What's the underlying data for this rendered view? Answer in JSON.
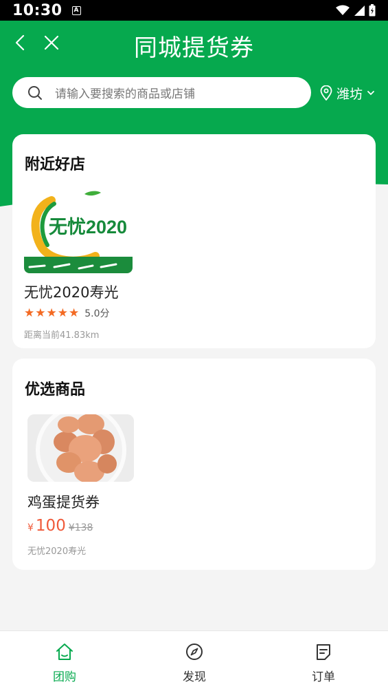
{
  "status_bar": {
    "time": "10:30",
    "notification_glyph": "A"
  },
  "nav": {
    "title": "同城提货券",
    "back_icon": "chevron-left-icon",
    "close_icon": "close-icon"
  },
  "search": {
    "placeholder": "请输入要搜索的商品或店铺"
  },
  "location": {
    "city": "潍坊"
  },
  "nearby": {
    "title": "附近好店",
    "store": {
      "name": "无忧2020寿光",
      "logo_text": "无忧2020",
      "rating_stars": 5,
      "rating_text": "5.0分",
      "distance": "距离当前41.83km"
    }
  },
  "featured": {
    "title": "优选商品",
    "product": {
      "name": "鸡蛋提货券",
      "currency": "¥",
      "price": "100",
      "original_price": "¥138",
      "store": "无忧2020寿光"
    }
  },
  "tabbar": {
    "items": [
      {
        "label": "团购",
        "icon": "home-icon",
        "active": true
      },
      {
        "label": "发现",
        "icon": "compass-icon",
        "active": false
      },
      {
        "label": "订单",
        "icon": "order-icon",
        "active": false
      }
    ]
  },
  "colors": {
    "brand_green": "#06a94e",
    "price_red": "#f05a3a",
    "star_orange": "#f36a23"
  }
}
